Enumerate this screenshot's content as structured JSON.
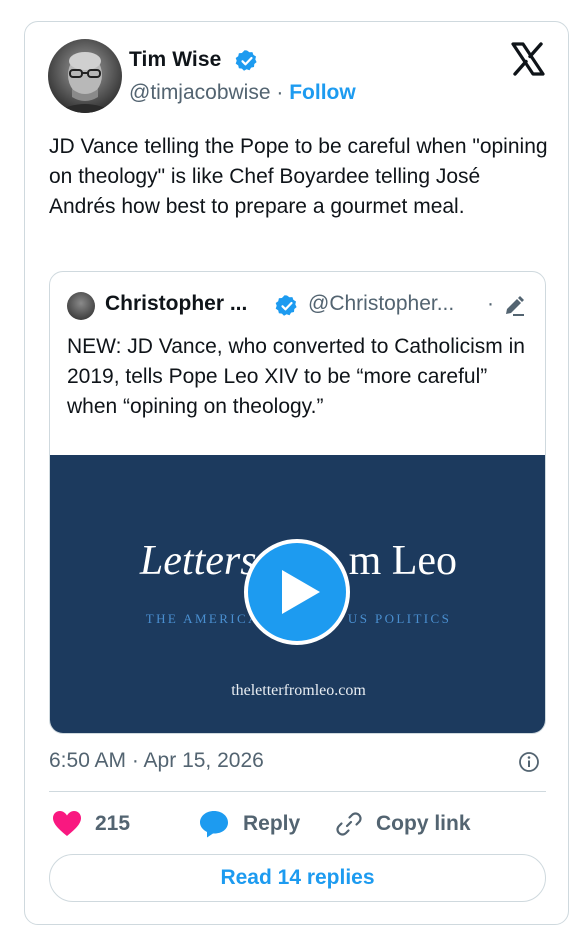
{
  "author": {
    "name": "Tim Wise",
    "handle": "@timjacobwise",
    "separator": "·",
    "follow_label": "Follow"
  },
  "tweet": {
    "text": "JD Vance telling the Pope to be careful when \"opining on theology\" is like Chef Boyardee telling José Andrés how best to prepare a gourmet meal.",
    "timestamp": "6:50 AM · Apr 15, 2026"
  },
  "quoted_tweet": {
    "name": "Christopher ...",
    "handle": "@Christopher...",
    "separator": "·",
    "text": "NEW: JD Vance, who converted to Catholicism in 2019, tells Pope Leo XIV to be “more careful” when “opining on theology.”",
    "media": {
      "brand_part1": "Letters",
      "brand_part2": "m Leo",
      "tagline_left": "THE AMERICA",
      "tagline_right": "US POLITICS",
      "site": "theletterfromleo.com"
    }
  },
  "actions": {
    "like_count": "215",
    "reply_label": "Reply",
    "copy_label": "Copy link"
  },
  "read_replies_label": "Read 14 replies",
  "colors": {
    "accent": "#1d9bf0",
    "like": "#f91880",
    "media_bg": "#1c3a5e",
    "muted_text": "#536471"
  }
}
